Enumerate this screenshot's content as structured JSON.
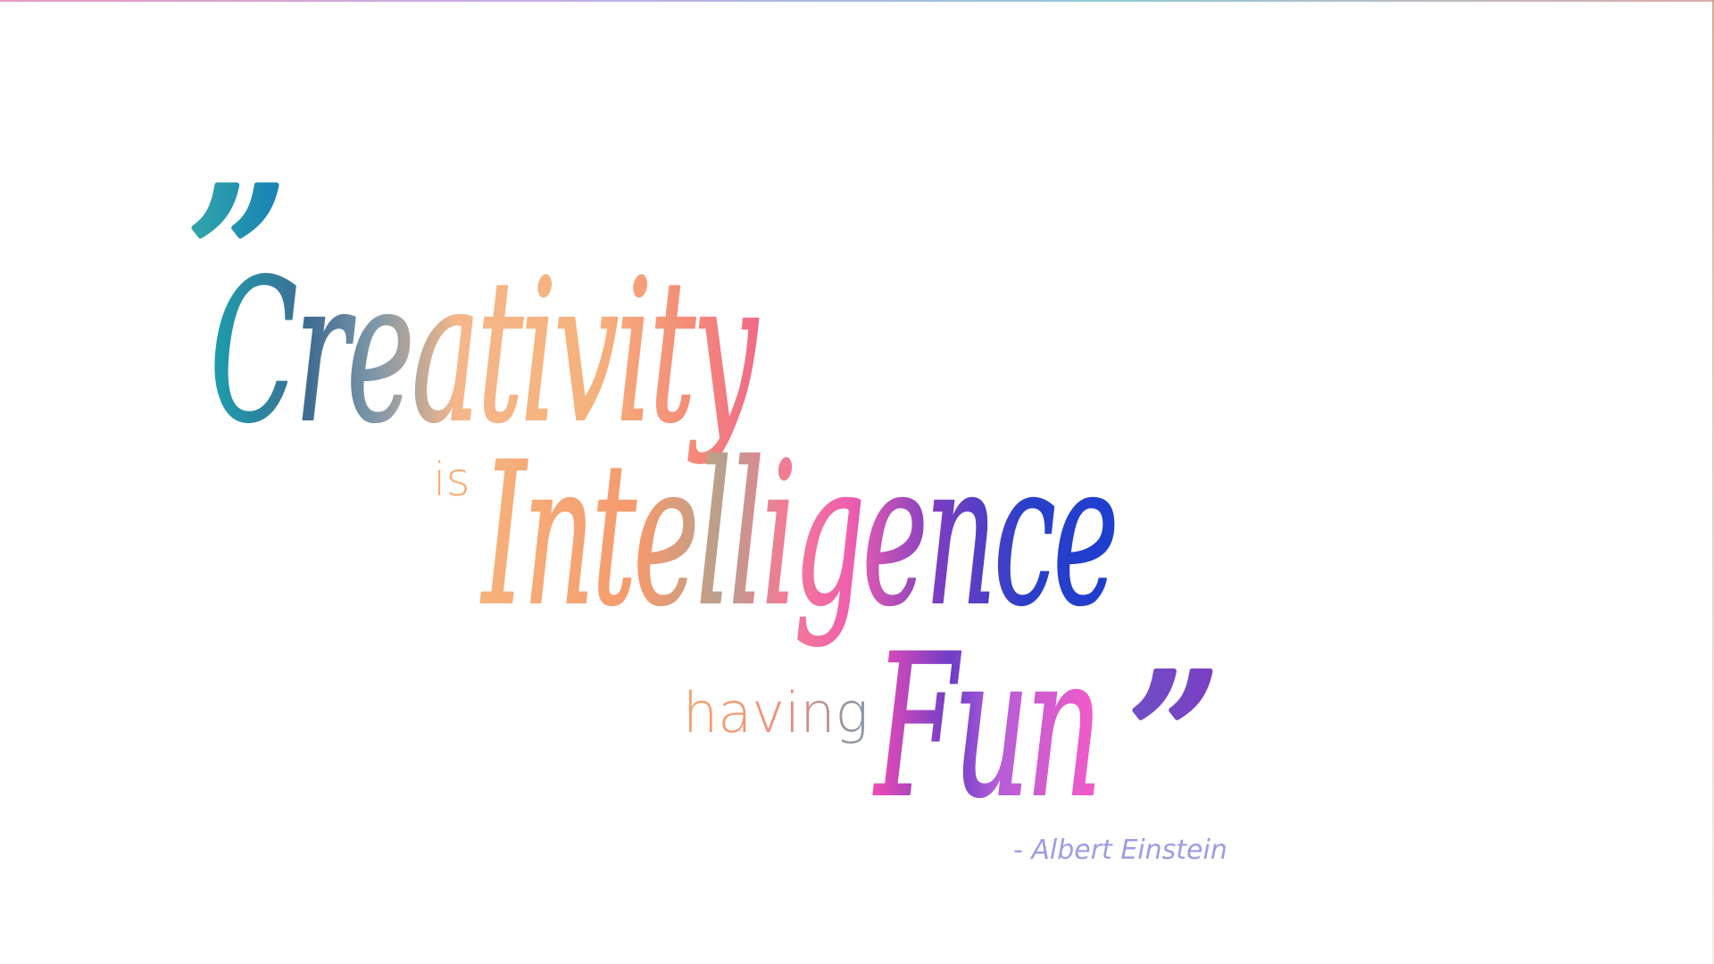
{
  "quote": {
    "open_mark": "”",
    "close_mark": "”",
    "word_creativity": "Creativity",
    "word_is": "is",
    "word_intelligence": "Intelligence",
    "word_having": "having",
    "word_fun": "Fun",
    "attribution": "- Albert Einstein"
  },
  "colors": {
    "teal": "#1ca6b2",
    "peach": "#f6b27c",
    "coral": "#f0788a",
    "magenta": "#f04cb4",
    "violet": "#6a3ec9",
    "royal_blue": "#1d3ecf",
    "grey_blue": "#7f97a8",
    "attribution_lavender": "#9d9ce6"
  }
}
